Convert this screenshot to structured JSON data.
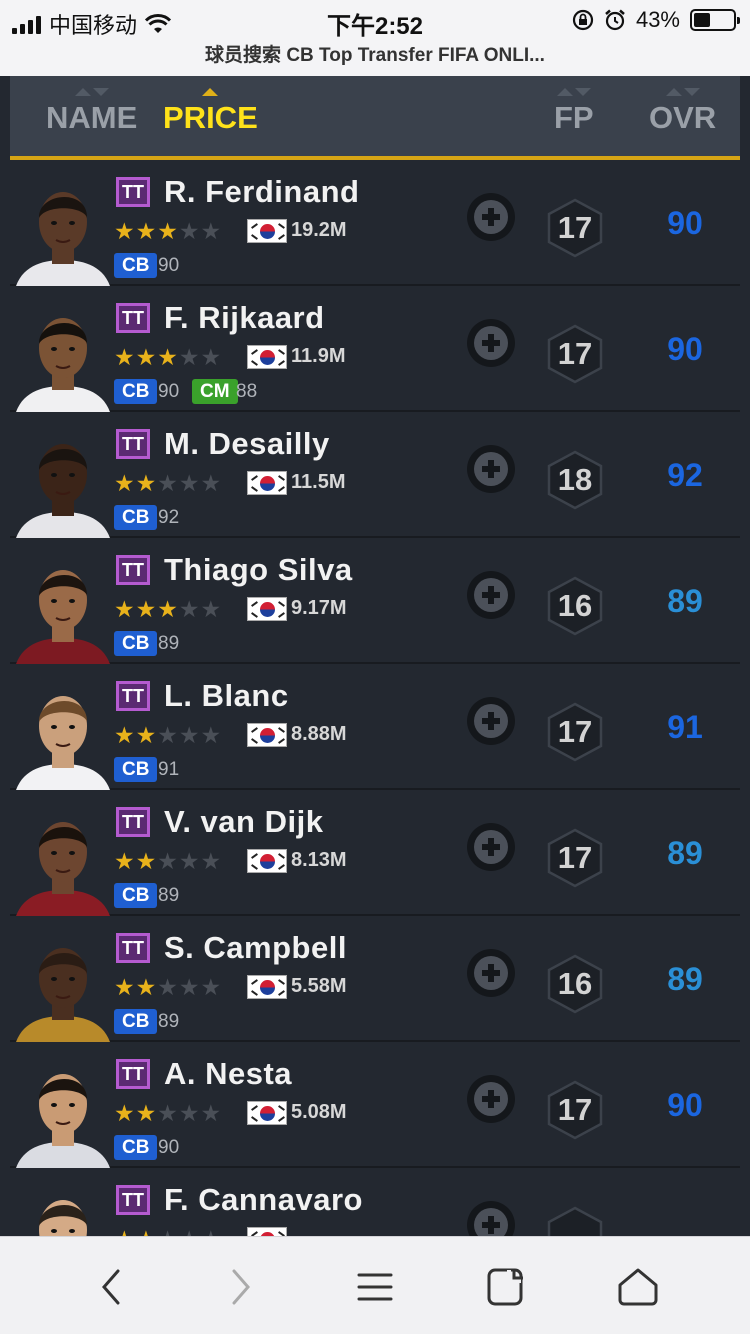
{
  "status_bar": {
    "carrier": "中国移动",
    "time": "下午2:52",
    "battery": "43%",
    "battery_level": 0.43,
    "url_title": "球员搜索 CB Top Transfer FIFA ONLI..."
  },
  "sort_header": {
    "name_label": "NAME",
    "price_label": "PRICE",
    "fp_label": "FP",
    "ovr_label": "OVR",
    "active": "PRICE"
  },
  "colors": {
    "accent_gold": "#d7a515",
    "active_sort": "#ffe21a",
    "ovr_dark_blue": "#1b66e0",
    "ovr_light_blue": "#2a8fd6",
    "cb_badge": "#1f5fd1",
    "cm_badge": "#3aa12b"
  },
  "players": [
    {
      "badge": "TT",
      "name": "R. Ferdinand",
      "stars": 3,
      "price": "19.2M",
      "positions": [
        {
          "pos": "CB",
          "val": "90"
        }
      ],
      "fp": "17",
      "ovr": "90",
      "ovr_shade": "dark"
    },
    {
      "badge": "TT",
      "name": "F. Rijkaard",
      "stars": 3,
      "price": "11.9M",
      "positions": [
        {
          "pos": "CB",
          "val": "90"
        },
        {
          "pos": "CM",
          "val": "88"
        }
      ],
      "fp": "17",
      "ovr": "90",
      "ovr_shade": "dark"
    },
    {
      "badge": "TT",
      "name": "M. Desailly",
      "stars": 2,
      "price": "11.5M",
      "positions": [
        {
          "pos": "CB",
          "val": "92"
        }
      ],
      "fp": "18",
      "ovr": "92",
      "ovr_shade": "dark"
    },
    {
      "badge": "TT",
      "name": "Thiago Silva",
      "stars": 3,
      "price": "9.17M",
      "positions": [
        {
          "pos": "CB",
          "val": "89"
        }
      ],
      "fp": "16",
      "ovr": "89",
      "ovr_shade": "light"
    },
    {
      "badge": "TT",
      "name": "L. Blanc",
      "stars": 2,
      "price": "8.88M",
      "positions": [
        {
          "pos": "CB",
          "val": "91"
        }
      ],
      "fp": "17",
      "ovr": "91",
      "ovr_shade": "dark"
    },
    {
      "badge": "TT",
      "name": "V. van Dijk",
      "stars": 2,
      "price": "8.13M",
      "positions": [
        {
          "pos": "CB",
          "val": "89"
        }
      ],
      "fp": "17",
      "ovr": "89",
      "ovr_shade": "light"
    },
    {
      "badge": "TT",
      "name": "S. Campbell",
      "stars": 2,
      "price": "5.58M",
      "positions": [
        {
          "pos": "CB",
          "val": "89"
        }
      ],
      "fp": "16",
      "ovr": "89",
      "ovr_shade": "light"
    },
    {
      "badge": "TT",
      "name": "A. Nesta",
      "stars": 2,
      "price": "5.08M",
      "positions": [
        {
          "pos": "CB",
          "val": "90"
        }
      ],
      "fp": "17",
      "ovr": "90",
      "ovr_shade": "dark"
    },
    {
      "badge": "TT",
      "name": "F. Cannavaro",
      "stars": 2,
      "price": "",
      "positions": [],
      "fp": "",
      "ovr": "",
      "ovr_shade": "light"
    }
  ],
  "bottom_nav": {
    "items": [
      "back-icon",
      "forward-icon",
      "menu-icon",
      "tabs-icon",
      "home-icon"
    ]
  }
}
